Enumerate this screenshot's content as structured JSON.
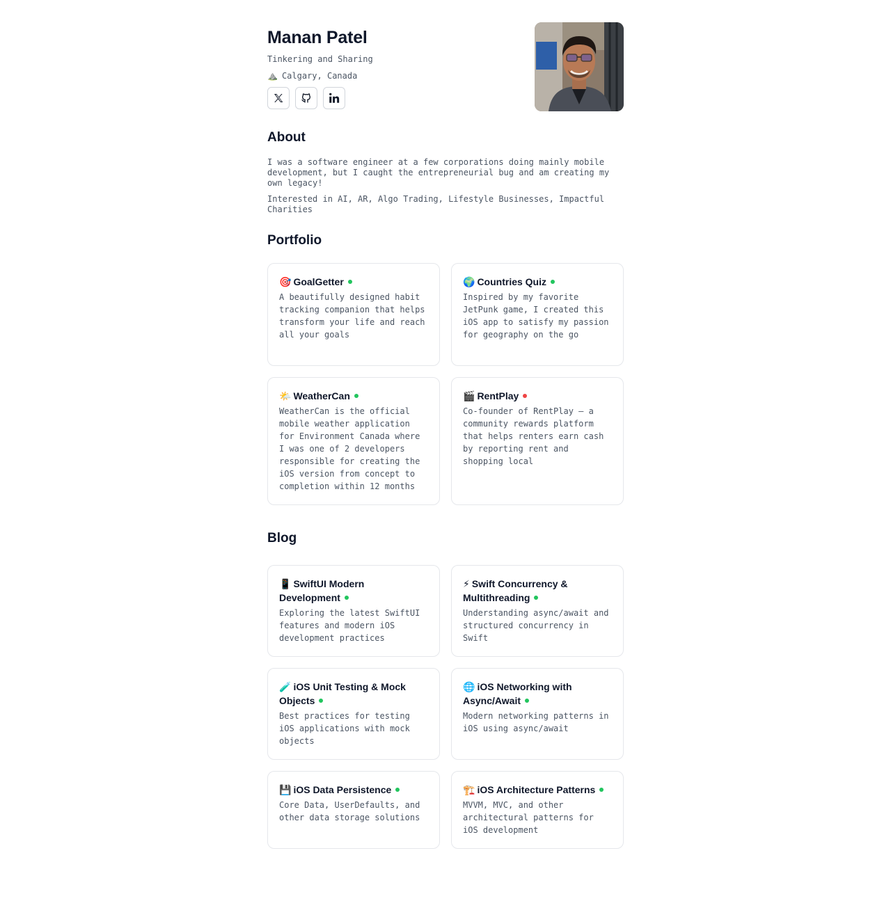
{
  "profile": {
    "name": "Manan Patel",
    "tagline": "Tinkering and Sharing",
    "location_emoji": "⛰️",
    "location": "Calgary, Canada"
  },
  "socials": [
    {
      "name": "x-icon"
    },
    {
      "name": "github-icon"
    },
    {
      "name": "linkedin-icon"
    }
  ],
  "about": {
    "title": "About",
    "p1": "I was a software engineer at a few corporations doing mainly mobile development, but I caught the entrepreneurial bug and am creating my own legacy!",
    "p2": "Interested in AI, AR, Algo Trading, Lifestyle Businesses, Impactful Charities"
  },
  "portfolio": {
    "title": "Portfolio",
    "items": [
      {
        "emoji": "🎯",
        "title": "GoalGetter",
        "status_color": "#22c55e",
        "description": "A beautifully designed habit tracking companion that helps transform your life and reach all your goals"
      },
      {
        "emoji": "🌍",
        "title": "Countries Quiz",
        "status_color": "#22c55e",
        "description": "Inspired by my favorite JetPunk game, I created this iOS app to satisfy my passion for geography on the go"
      },
      {
        "emoji": "🌤️",
        "title": "WeatherCan",
        "status_color": "#22c55e",
        "description": "WeatherCan is the official mobile weather application for Environment Canada where I was one of 2 developers responsible for creating the iOS version from concept to completion within 12 months"
      },
      {
        "emoji": "🎬",
        "title": "RentPlay",
        "status_color": "#ef4444",
        "description": "Co-founder of RentPlay – a community rewards platform that helps renters earn cash by reporting rent and shopping local"
      }
    ]
  },
  "blog": {
    "title": "Blog",
    "items": [
      {
        "emoji": "📱",
        "title": "SwiftUI Modern Development",
        "status_color": "#22c55e",
        "description": "Exploring the latest SwiftUI features and modern iOS development practices"
      },
      {
        "emoji": "⚡",
        "title": "Swift Concurrency & Multithreading",
        "status_color": "#22c55e",
        "description": "Understanding async/await and structured concurrency in Swift"
      },
      {
        "emoji": "🧪",
        "title": "iOS Unit Testing & Mock Objects",
        "status_color": "#22c55e",
        "description": "Best practices for testing iOS applications with mock objects"
      },
      {
        "emoji": "🌐",
        "title": "iOS Networking with Async/Await",
        "status_color": "#22c55e",
        "description": "Modern networking patterns in iOS using async/await"
      },
      {
        "emoji": "💾",
        "title": "iOS Data Persistence",
        "status_color": "#22c55e",
        "description": "Core Data, UserDefaults, and other data storage solutions"
      },
      {
        "emoji": "🏗️",
        "title": "iOS Architecture Patterns",
        "status_color": "#22c55e",
        "description": "MVVM, MVC, and other architectural patterns for iOS development"
      }
    ]
  }
}
